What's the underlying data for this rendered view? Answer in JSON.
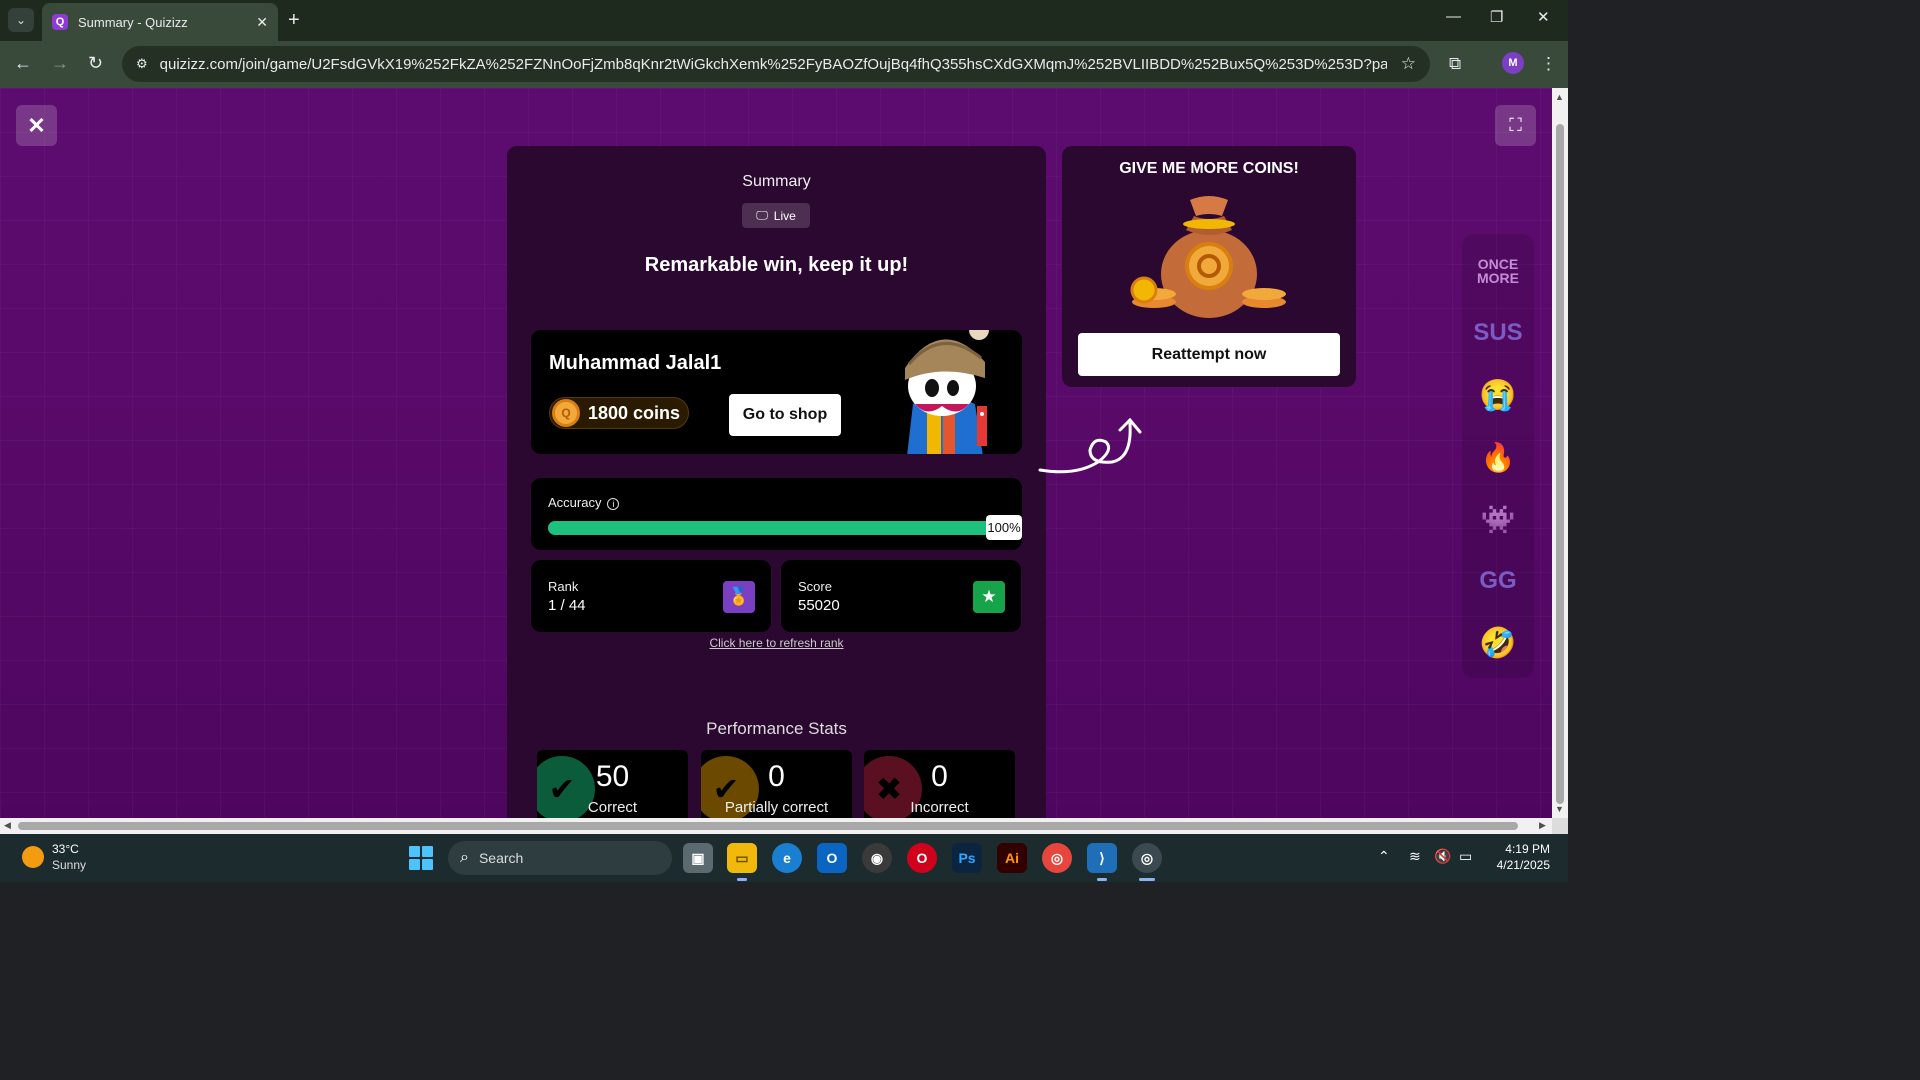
{
  "browser": {
    "tab_title": "Summary - Quizizz",
    "tab_favicon": "Q",
    "url": "quizizz.com/join/game/U2FsdGVkX19%252FkZA%252FZNnOoFjZmb8qKnr2tWiGkchXemk%252FyBAOZfOujBq4fhQ355hsCXdGXMqmJ%252BVLIIBDD%252Bux5Q%253D%253D?page=nps&pag...",
    "profile_initial": "M"
  },
  "summary": {
    "title": "Summary",
    "live_label": "Live",
    "headline": "Remarkable win, keep it up!"
  },
  "player": {
    "name": "Muhammad Jalal1",
    "coins": "1800 coins",
    "shop_label": "Go to shop"
  },
  "accuracy": {
    "label": "Accuracy",
    "value_text": "100%",
    "fraction": 1.0
  },
  "rank": {
    "label": "Rank",
    "value": "1 / 44"
  },
  "score": {
    "label": "Score",
    "value": "55020"
  },
  "refresh_link": "Click here to refresh rank",
  "performance": {
    "title": "Performance Stats",
    "items": [
      {
        "value": "50",
        "label": "Correct",
        "color": "#0b5c3a"
      },
      {
        "value": "0",
        "label": "Partially correct",
        "color": "#6b4a00"
      },
      {
        "value": "0",
        "label": "Incorrect",
        "color": "#5a1020"
      }
    ]
  },
  "coins_promo": {
    "title": "GIVE ME MORE COINS!",
    "button": "Reattempt now"
  },
  "stickers": [
    {
      "label": "ONCE MORE",
      "icon": "once-more-sticker"
    },
    {
      "label": "SUS",
      "icon": "sus-sticker"
    },
    {
      "label": "",
      "icon": "crying-face-sticker"
    },
    {
      "label": "",
      "icon": "fire-p-sticker"
    },
    {
      "label": "",
      "icon": "among-us-sticker"
    },
    {
      "label": "GG",
      "icon": "gg-sticker"
    },
    {
      "label": "",
      "icon": "laughing-face-sticker"
    }
  ],
  "taskbar": {
    "temperature": "33°C",
    "condition": "Sunny",
    "search_placeholder": "Search",
    "time": "4:19 PM",
    "date": "4/21/2025"
  },
  "colors": {
    "accent_green": "#1ec07d",
    "rank_icon_bg": "#7b3fc4",
    "score_icon_bg": "#16a34a",
    "page_bg": "#5c0c6f"
  }
}
